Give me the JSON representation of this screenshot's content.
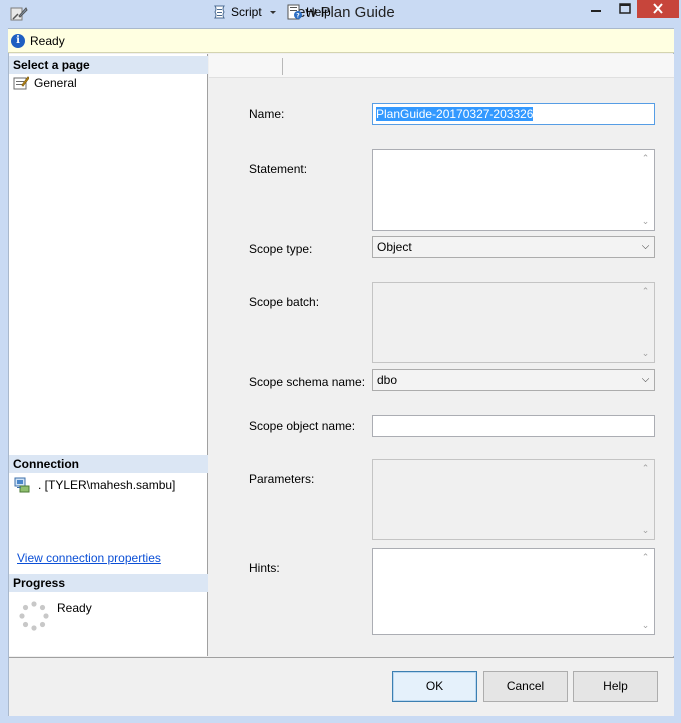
{
  "window": {
    "title": "New Plan Guide"
  },
  "status": {
    "text": "Ready"
  },
  "left": {
    "select_page_header": "Select a page",
    "pages": [
      {
        "label": "General",
        "icon": "page-general-icon"
      }
    ],
    "connection_header": "Connection",
    "connection_label": ". [TYLER\\mahesh.sambu]",
    "view_connection_link": "View connection properties",
    "progress_header": "Progress",
    "progress_text": "Ready"
  },
  "toolbar": {
    "script_label": "Script",
    "help_label": "Help"
  },
  "form": {
    "name_label": "Name:",
    "name_value": "PlanGuide-20170327-203326",
    "statement_label": "Statement:",
    "statement_value": "",
    "scope_type_label": "Scope type:",
    "scope_type_value": "Object",
    "scope_batch_label": "Scope batch:",
    "scope_schema_label": "Scope schema name:",
    "scope_schema_value": "dbo",
    "scope_object_label": "Scope object name:",
    "scope_object_value": "",
    "parameters_label": "Parameters:",
    "hints_label": "Hints:"
  },
  "buttons": {
    "ok": "OK",
    "cancel": "Cancel",
    "help": "Help"
  },
  "colors": {
    "titlebar": "#c9daf3",
    "close": "#c7453b",
    "link": "#0b4fd6",
    "selection": "#3399ff",
    "status_bg": "#ffffe1"
  }
}
